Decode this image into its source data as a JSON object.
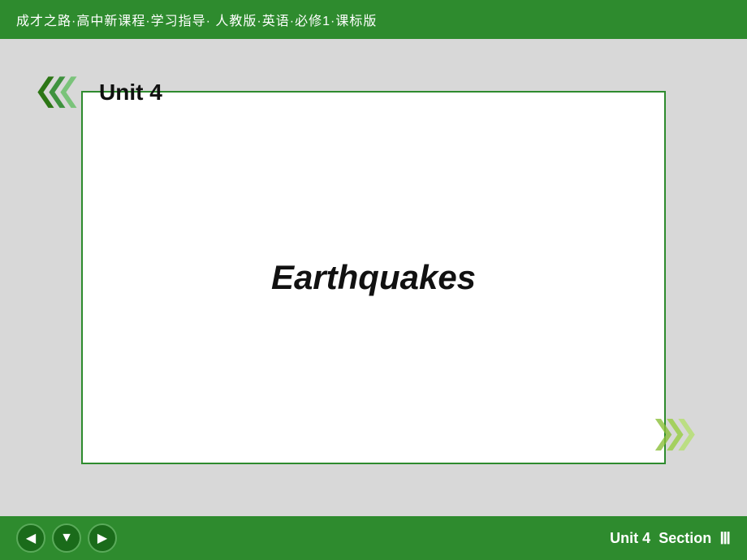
{
  "header": {
    "text": "成才之路·高中新课程·学习指导· 人教版·英语·必修1·课标版"
  },
  "slide": {
    "unit_label": "Unit 4",
    "main_title": "Earthquakes"
  },
  "footer": {
    "unit_label": "Unit 4",
    "section_label": "Section",
    "section_number": "Ⅲ",
    "nav_prev_label": "◀",
    "nav_down_label": "▼",
    "nav_next_label": "▶"
  }
}
